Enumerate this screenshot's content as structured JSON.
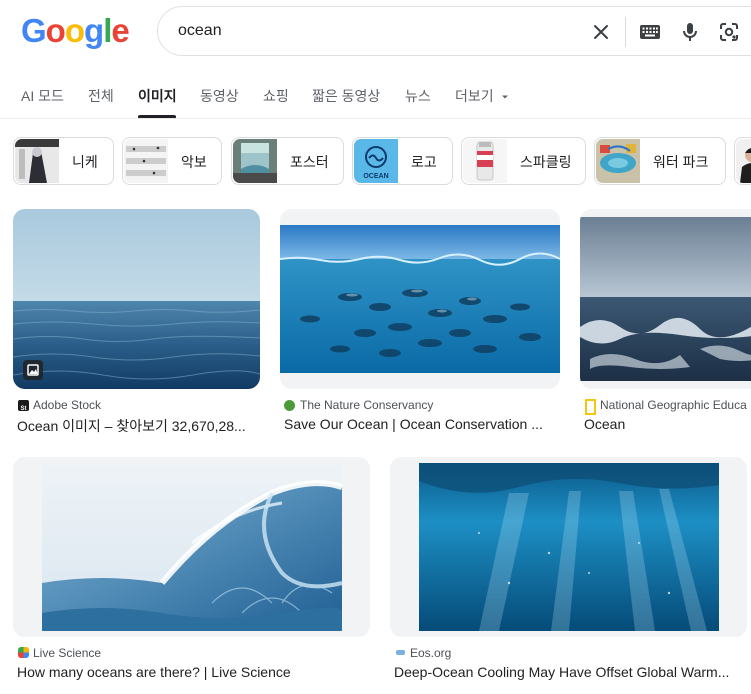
{
  "logo": {
    "letters": [
      "G",
      "o",
      "o",
      "g",
      "l",
      "e"
    ],
    "colors": [
      "#4285F4",
      "#EA4335",
      "#FBBC05",
      "#4285F4",
      "#34A853",
      "#EA4335"
    ]
  },
  "search": {
    "query": "ocean",
    "icons": [
      "clear-icon",
      "keyboard-icon",
      "mic-icon",
      "lens-icon"
    ]
  },
  "tabs": [
    {
      "label": "AI 모드"
    },
    {
      "label": "전체"
    },
    {
      "label": "이미지",
      "active": true
    },
    {
      "label": "동영상"
    },
    {
      "label": "쇼핑"
    },
    {
      "label": "짧은 동영상"
    },
    {
      "label": "뉴스"
    },
    {
      "label": "더보기"
    }
  ],
  "chips": [
    {
      "label": "니케"
    },
    {
      "label": "악보"
    },
    {
      "label": "포스터"
    },
    {
      "label": "로고"
    },
    {
      "label": "스파클링"
    },
    {
      "label": "워터 파크"
    }
  ],
  "chip_logo_text": "OCEAN",
  "results": [
    {
      "source": "Adobe Stock",
      "title": "Ocean 이미지 – 찾아보기 32,670,28...",
      "favicon_text": "St"
    },
    {
      "source": "The Nature Conservancy",
      "title": "Save Our Ocean | Ocean Conservation ..."
    },
    {
      "source": "National Geographic Educa",
      "title": "Ocean"
    },
    {
      "source": "Live Science",
      "title": "How many oceans are there? | Live Science"
    },
    {
      "source": "Eos.org",
      "title": "Deep-Ocean Cooling May Have Offset Global Warm..."
    }
  ],
  "colors": {
    "accent": "#1a73e8",
    "text": "#202124",
    "muted": "#5f6368",
    "border": "#dadce0"
  }
}
